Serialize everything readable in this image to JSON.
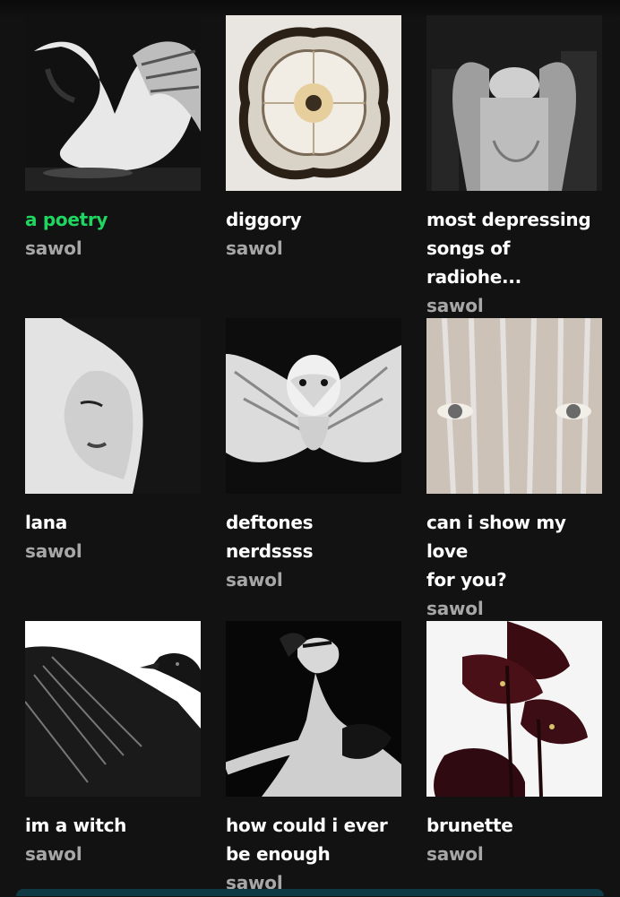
{
  "colors": {
    "background": "#121212",
    "active_title": "#1ed760",
    "owner_text": "#a7a7a7"
  },
  "playlists": [
    {
      "title": "a poetry",
      "owner": "sawol",
      "active": true,
      "cover": "swan"
    },
    {
      "title": "diggory",
      "owner": "sawol",
      "active": false,
      "cover": "flower"
    },
    {
      "title": "most depressing songs of radiohe...",
      "title_line1": "most depressing",
      "title_line2": "songs of radiohe...",
      "owner": "sawol",
      "active": false,
      "cover": "angel-statue"
    },
    {
      "title": "lana",
      "owner": "sawol",
      "active": false,
      "cover": "woman-portrait"
    },
    {
      "title": "deftones nerdssss",
      "owner": "sawol",
      "active": false,
      "cover": "owl"
    },
    {
      "title": "can i show my love for you?",
      "title_line1": "can i show my love",
      "title_line2": "for you?",
      "owner": "sawol",
      "active": false,
      "cover": "veiled-eyes"
    },
    {
      "title": "im a witch",
      "owner": "sawol",
      "active": false,
      "cover": "crow"
    },
    {
      "title": "how could i ever be enough",
      "title_line1": "how could i ever",
      "title_line2": "be enough",
      "owner": "sawol",
      "active": false,
      "cover": "black-swan-dancer"
    },
    {
      "title": "brunette",
      "owner": "sawol",
      "active": false,
      "cover": "calla-lilies"
    }
  ]
}
